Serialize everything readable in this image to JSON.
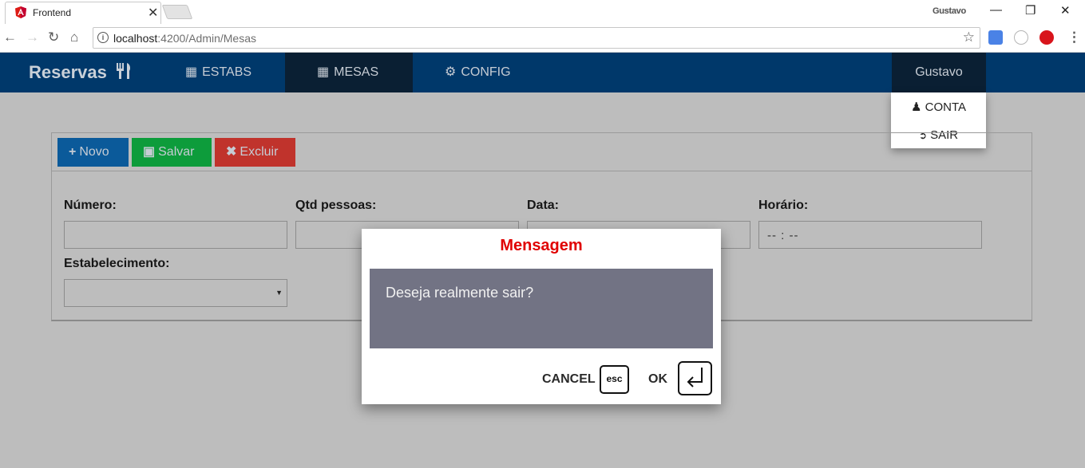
{
  "browser": {
    "tab_title": "Frontend",
    "tab_close": "✕",
    "profile": "Gustavo",
    "url_host": "localhost",
    "url_path": ":4200/Admin/Mesas",
    "window_controls": {
      "minimize": "—",
      "restore": "❐",
      "close": "✕"
    }
  },
  "nav": {
    "brand": "Reservas",
    "items": [
      {
        "label": "ESTABS",
        "icon": "building-icon"
      },
      {
        "label": "MESAS",
        "icon": "grid-icon"
      },
      {
        "label": "CONFIG",
        "icon": "gear-icon"
      }
    ],
    "user": "Gustavo"
  },
  "user_dropdown": {
    "items": [
      {
        "label": "CONTA",
        "icon": "user-icon"
      },
      {
        "label": "SAIR",
        "icon": "logout-icon"
      }
    ]
  },
  "toolbar": {
    "new_label": "Novo",
    "save_label": "Salvar",
    "delete_label": "Excluir"
  },
  "form": {
    "numero_label": "Número:",
    "qtd_label": "Qtd pessoas:",
    "data_label": "Data:",
    "horario_label": "Horário:",
    "horario_value": "-- : --",
    "estabelecimento_label": "Estabelecimento:"
  },
  "modal": {
    "title": "Mensagem",
    "message": "Deseja realmente sair?",
    "cancel_label": "CANCEL",
    "cancel_key": "esc",
    "ok_label": "OK"
  },
  "colors": {
    "navbar": "#00386a",
    "navbar_active": "#0a1f33",
    "overlay_bg": "#bdbdbd",
    "btn_new": "#0b5a9a",
    "btn_save": "#0d9c3b",
    "btn_delete": "#c0332c",
    "modal_title": "#e00000",
    "modal_body": "#727384"
  }
}
